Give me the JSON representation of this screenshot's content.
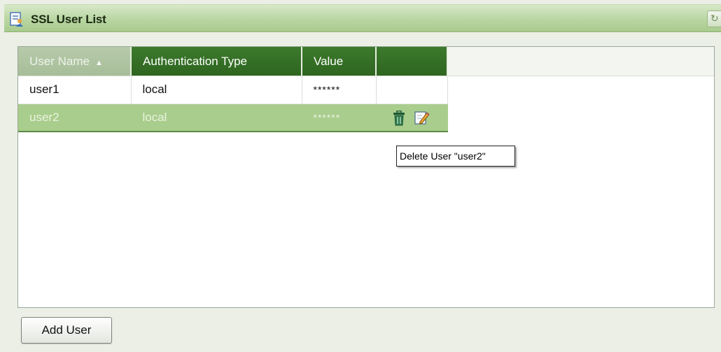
{
  "window": {
    "title": "SSL User List",
    "refresh_icon": "refresh-icon"
  },
  "table": {
    "columns": [
      {
        "label": "User Name",
        "sorted": "ascending"
      },
      {
        "label": "Authentication Type"
      },
      {
        "label": "Value"
      },
      {
        "label": ""
      }
    ],
    "rows": [
      {
        "user": "user1",
        "auth": "local",
        "value": "******",
        "selected": false
      },
      {
        "user": "user2",
        "auth": "local",
        "value": "******",
        "selected": true
      }
    ],
    "row_actions": {
      "delete_icon": "trash-icon",
      "edit_icon": "edit-icon"
    }
  },
  "tooltip": {
    "text": "Delete User \"user2\""
  },
  "footer": {
    "add_button": "Add User"
  },
  "colors": {
    "header_green": "#2e6520",
    "titlebar_green": "#b9d6a2",
    "selected_row": "#a9cd8c"
  }
}
